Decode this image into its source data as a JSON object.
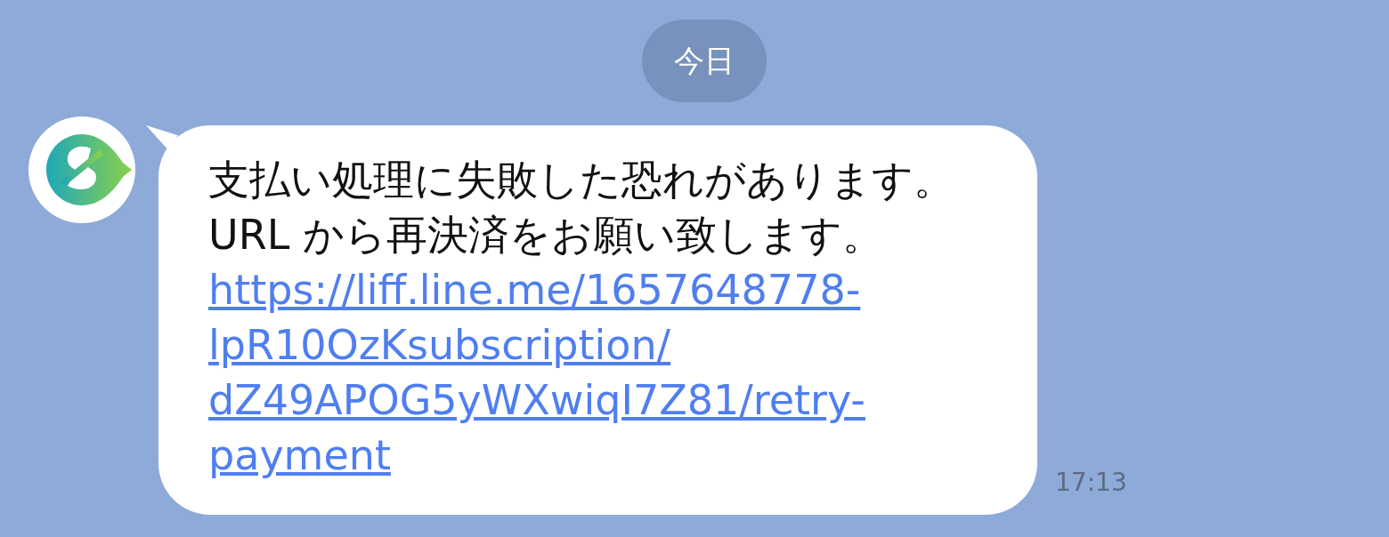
{
  "date_separator": "今日",
  "message": {
    "text": "支払い処理に失敗した恐れがあります。\nURL から再決済をお願い致します。",
    "link_lines": [
      "https://liff.line.me/1657648778-",
      "lpR10OzKsubscription/",
      "dZ49APOG5yWXwiqI7Z81/retry-",
      "payment"
    ],
    "time": "17:13"
  }
}
